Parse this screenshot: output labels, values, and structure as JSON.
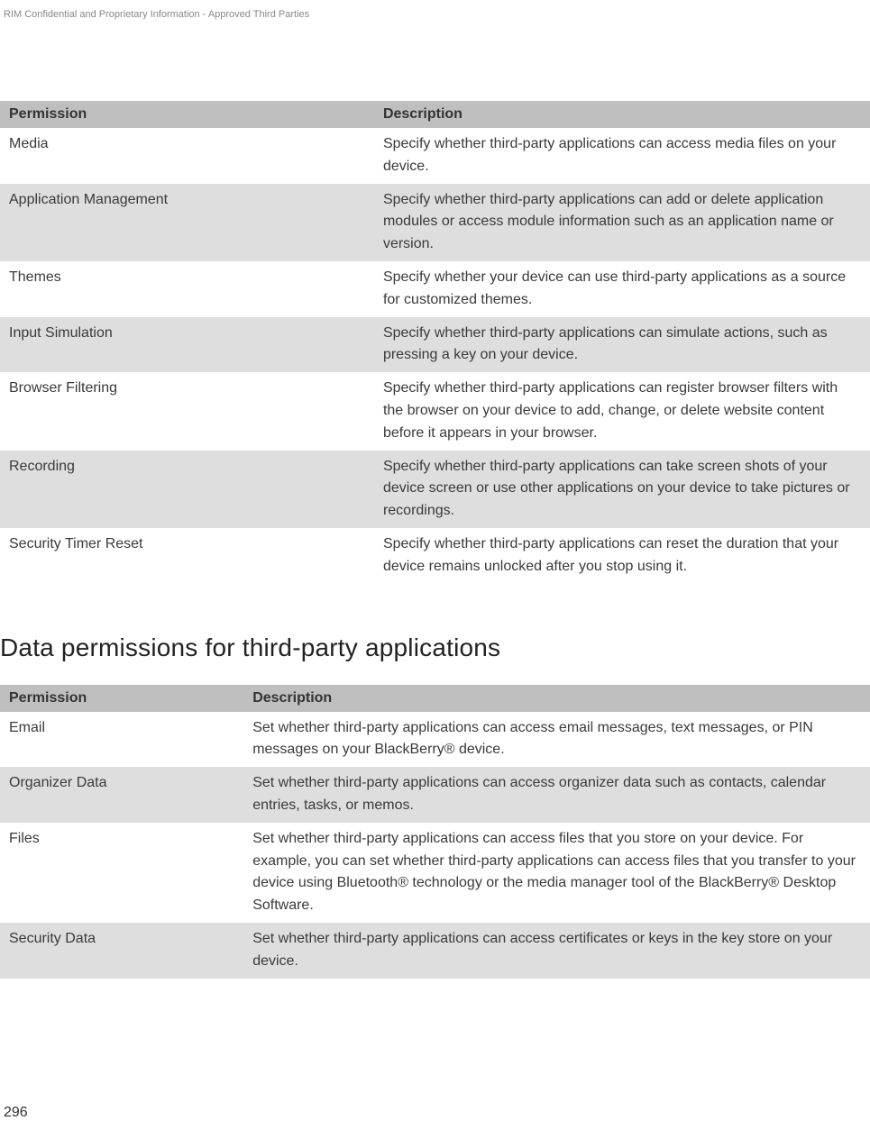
{
  "header_note": "RIM Confidential and Proprietary Information - Approved Third Parties",
  "table1": {
    "headers": [
      "Permission",
      "Description"
    ],
    "rows": [
      {
        "permission": "Media",
        "description": "Specify whether third-party applications can access media files on your device."
      },
      {
        "permission": "Application Management",
        "description": "Specify whether third-party applications can add or delete application modules or access module information such as an application name or version."
      },
      {
        "permission": "Themes",
        "description": "Specify whether your device can use third-party applications as a source for customized themes."
      },
      {
        "permission": "Input Simulation",
        "description": "Specify whether third-party applications can simulate actions, such as pressing a key on your device."
      },
      {
        "permission": "Browser Filtering",
        "description": "Specify whether third-party applications can register browser filters with the browser on your device to add, change, or delete website content before it appears in your browser."
      },
      {
        "permission": "Recording",
        "description": "Specify whether third-party applications can take screen shots of your device screen or use other applications on your device to take pictures or recordings."
      },
      {
        "permission": "Security Timer Reset",
        "description": "Specify whether third-party applications can reset the duration that your device remains unlocked after you stop using it."
      }
    ]
  },
  "section_title": "Data permissions for third-party applications",
  "table2": {
    "headers": [
      "Permission",
      "Description"
    ],
    "rows": [
      {
        "permission": "Email",
        "description": "Set whether third-party applications can access email messages, text messages, or PIN messages on your BlackBerry® device."
      },
      {
        "permission": "Organizer Data",
        "description": "Set whether third-party applications can access organizer data such as contacts, calendar entries, tasks, or memos."
      },
      {
        "permission": "Files",
        "description": "Set whether third-party applications can access files that you store on your device. For example, you can set whether third-party applications can access files that you transfer to your device using Bluetooth® technology or the media manager tool of the BlackBerry® Desktop Software."
      },
      {
        "permission": "Security Data",
        "description": "Set whether third-party applications can access certificates or keys in the key store on your device."
      }
    ]
  },
  "page_number": "296"
}
